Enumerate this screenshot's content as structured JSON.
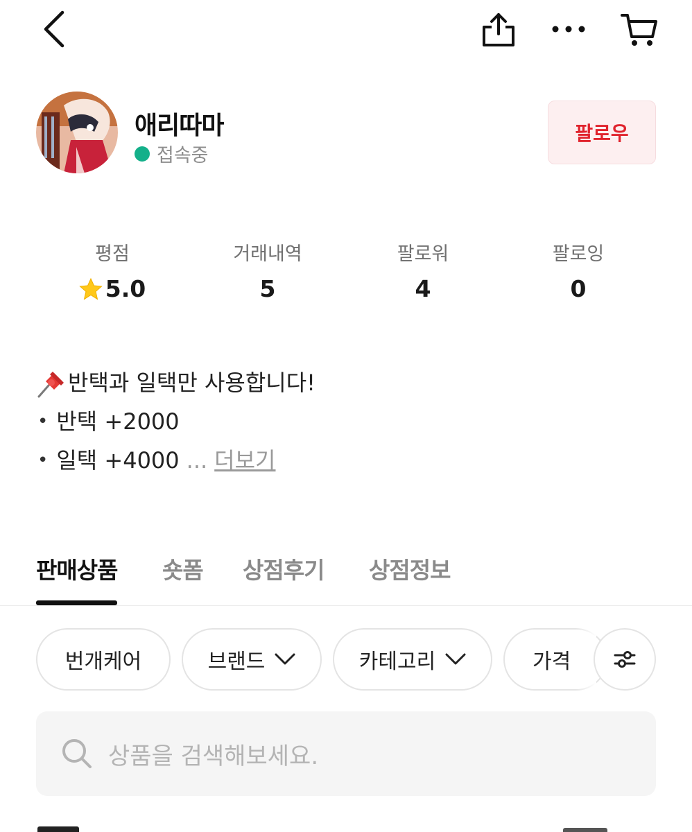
{
  "header": {
    "back_icon": "chevron-left-icon",
    "share_icon": "share-icon",
    "more_icon": "more-horizontal-icon",
    "cart_icon": "cart-icon"
  },
  "profile": {
    "name": "애리따마",
    "status": "접속중",
    "status_color": "#14b08a",
    "follow_label": "팔로우",
    "follow_color": "#e0232d"
  },
  "stats": [
    {
      "label": "평점",
      "value": "5.0",
      "icon": "star-icon"
    },
    {
      "label": "거래내역",
      "value": "5"
    },
    {
      "label": "팔로워",
      "value": "4"
    },
    {
      "label": "팔로잉",
      "value": "0"
    }
  ],
  "bio": {
    "line1": "반택과 일택만 사용합니다!",
    "line1_icon": "pushpin-icon",
    "line2": "반택 +2000",
    "line3": "일택 +4000",
    "bullet": "•",
    "ellipsis": "...",
    "more_label": "더보기"
  },
  "tabs": [
    {
      "label": "판매상품",
      "active": true
    },
    {
      "label": "숏폼",
      "active": false
    },
    {
      "label": "상점후기",
      "active": false
    },
    {
      "label": "상점정보",
      "active": false
    }
  ],
  "filters": [
    {
      "label": "번개케어",
      "dropdown": false
    },
    {
      "label": "브랜드",
      "dropdown": true
    },
    {
      "label": "카테고리",
      "dropdown": true
    },
    {
      "label": "가격",
      "dropdown": false
    }
  ],
  "filter_button_icon": "sliders-icon",
  "search": {
    "placeholder": "상품을 검색해보세요.",
    "icon": "search-icon"
  }
}
